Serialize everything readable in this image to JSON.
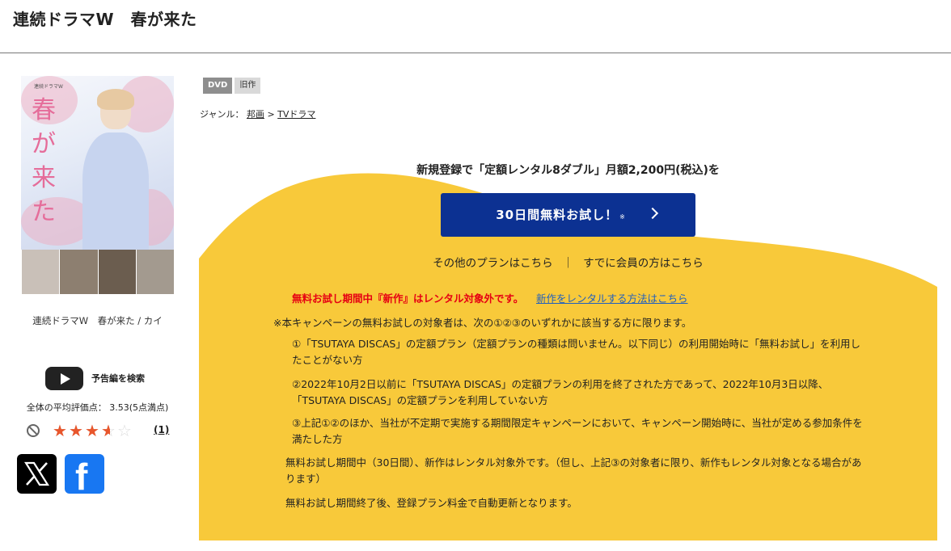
{
  "page": {
    "title": "連続ドラマW　春が来た"
  },
  "product": {
    "name": "連続ドラマW　春が来た / カイ",
    "jacket_title": "春が来た",
    "jacket_logo": "連続ドラマW"
  },
  "trailer": {
    "label": "予告編を検索",
    "icon": "youtube-play-icon"
  },
  "rating": {
    "average_text": "全体の平均評価点： 3.53(5点満点)",
    "value": 3.53,
    "max": 5,
    "review_count": "(1)"
  },
  "share": {
    "x_icon": "x-logo-icon",
    "facebook_icon": "facebook-logo-icon",
    "facebook_glyph": "f"
  },
  "tags": [
    {
      "label": "DVD"
    },
    {
      "label": "旧作"
    }
  ],
  "genre": {
    "prefix": "ジャンル：",
    "items": [
      "邦画",
      "TVドラマ"
    ],
    "separator": ">"
  },
  "campaign": {
    "headline": "新規登録で「定額レンタル8ダブル」月額2,200円(税込)を",
    "button_label": "30日間無料お試し！",
    "button_note": "※",
    "other_plans": "その他のプランはこちら",
    "divider": "｜",
    "members": "すでに会員の方はこちら",
    "notice_red": "無料お試し期間中『新作』はレンタル対象外です。",
    "notice_link": "新作をレンタルする方法はこちら",
    "conditions_intro": "※本キャンペーンの無料お試しの対象者は、次の①②③のいずれかに該当する方に限ります。",
    "conditions": [
      "①「TSUTAYA DISCAS」の定額プラン（定額プランの種類は問いません。以下同じ）の利用開始時に「無料お試し」を利用したことがない方",
      "②2022年10月2日以前に「TSUTAYA DISCAS」の定額プランの利用を終了された方であって、2022年10月3日以降、「TSUTAYA DISCAS」の定額プランを利用していない方",
      "③上記①②のほか、当社が不定期で実施する期間限定キャンペーンにおいて、キャンペーン開始時に、当社が定める参加条件を満たした方"
    ],
    "extra_notes": [
      "無料お試し期間中（30日間）、新作はレンタル対象外です。（但し、上記③の対象者に限り、新作もレンタル対象となる場合があります）",
      "無料お試し期間終了後、登録プラン料金で自動更新となります。"
    ]
  },
  "colors": {
    "campaign_yellow": "#f8c93a",
    "button_navy": "#0c3192",
    "notice_red": "#e60012",
    "star_orange": "#e8562c",
    "facebook_blue": "#1877f2"
  }
}
